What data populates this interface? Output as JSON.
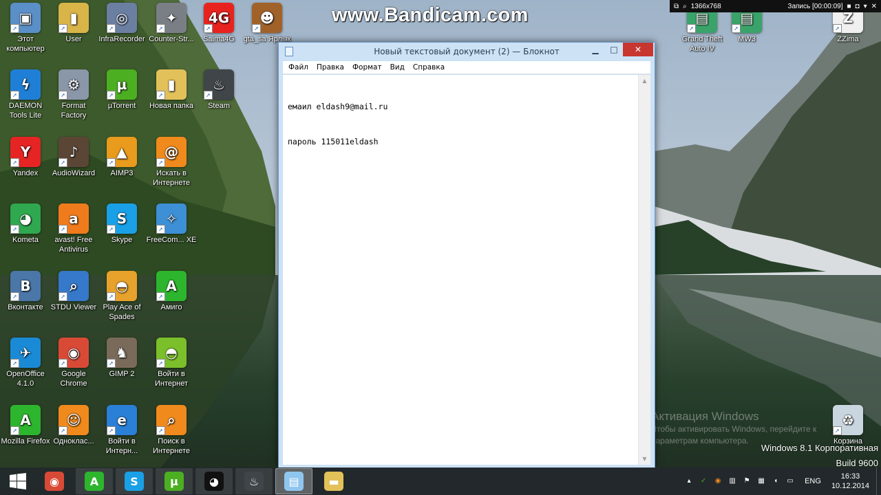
{
  "watermark": "www.Bandicam.com",
  "recorder": {
    "resolution": "1366x768",
    "recording": "Запись [00:00:09]"
  },
  "desktop_icons": [
    {
      "label": "Этот компьютер",
      "icon": "computer-icon",
      "color": "#5a8fc8",
      "glyph": "▣"
    },
    {
      "label": "User",
      "icon": "user-folder-icon",
      "color": "#d9b449",
      "glyph": "▮"
    },
    {
      "label": "InfraRecorder",
      "icon": "infrarecorder-icon",
      "color": "#6b7fa3",
      "glyph": "◎"
    },
    {
      "label": "Counter-Str...",
      "icon": "counter-strike-icon",
      "color": "#7a7f86",
      "glyph": "✦"
    },
    {
      "label": "Saima4G",
      "icon": "saima-4g-icon",
      "color": "#e8231f",
      "glyph": "4G"
    },
    {
      "label": "gta_sa Ярлык",
      "icon": "gta-sa-icon",
      "color": "#a1622a",
      "glyph": "☻"
    },
    {
      "label": "DAEMON Tools Lite",
      "icon": "daemon-tools-icon",
      "color": "#1f7fd6",
      "glyph": "ϟ"
    },
    {
      "label": "Format Factory",
      "icon": "format-factory-icon",
      "color": "#8a97a8",
      "glyph": "⚙"
    },
    {
      "label": "µTorrent",
      "icon": "utorrent-icon",
      "color": "#4caf22",
      "glyph": "µ"
    },
    {
      "label": "Новая папка",
      "icon": "folder-icon",
      "color": "#e3c15a",
      "glyph": "▮"
    },
    {
      "label": "Steam",
      "icon": "steam-icon",
      "color": "#3f4549",
      "glyph": "♨"
    },
    {
      "label": "Yandex",
      "icon": "yandex-browser-icon",
      "color": "#e62424",
      "glyph": "Y"
    },
    {
      "label": "AudioWizard",
      "icon": "audiowizard-icon",
      "color": "#5b4636",
      "glyph": "♪"
    },
    {
      "label": "AIMP3",
      "icon": "aimp-icon",
      "color": "#e89b1c",
      "glyph": "▲"
    },
    {
      "label": "Искать в Интернете",
      "icon": "internet-search-icon",
      "color": "#f08a1c",
      "glyph": "@"
    },
    {
      "label": "Kometa",
      "icon": "kometa-icon",
      "color": "#2fa84f",
      "glyph": "◕"
    },
    {
      "label": "avast! Free Antivirus",
      "icon": "avast-icon",
      "color": "#f07b1c",
      "glyph": "a"
    },
    {
      "label": "Skype",
      "icon": "skype-icon",
      "color": "#1aa0e6",
      "glyph": "S"
    },
    {
      "label": "FreeCom... XE",
      "icon": "freecommander-icon",
      "color": "#3d8fd6",
      "glyph": "✧"
    },
    {
      "label": "Вконтакте",
      "icon": "vkontakte-icon",
      "color": "#4a76a8",
      "glyph": "B"
    },
    {
      "label": "STDU Viewer",
      "icon": "stdu-viewer-icon",
      "color": "#3678c9",
      "glyph": "⌕"
    },
    {
      "label": "Play Ace of Spades",
      "icon": "ace-of-spades-icon",
      "color": "#e7a22b",
      "glyph": "◓"
    },
    {
      "label": "Амиго",
      "icon": "amigo-icon",
      "color": "#2eb52e",
      "glyph": "A"
    },
    {
      "label": "OpenOffice 4.1.0",
      "icon": "openoffice-icon",
      "color": "#1b8ad6",
      "glyph": "✈"
    },
    {
      "label": "Google Chrome",
      "icon": "chrome-icon",
      "color": "#d94a36",
      "glyph": "◉"
    },
    {
      "label": "GIMP 2",
      "icon": "gimp-icon",
      "color": "#7a6a5a",
      "glyph": "♞"
    },
    {
      "label": "Войти в Интернет",
      "icon": "internet-login-icon",
      "color": "#7bbf2a",
      "glyph": "◓"
    },
    {
      "label": "Mozilla Firefox",
      "icon": "amigo-firefox-icon",
      "color": "#2eb52e",
      "glyph": "A"
    },
    {
      "label": "Одноклас...",
      "icon": "odnoklassniki-icon",
      "color": "#f08a1c",
      "glyph": "☺"
    },
    {
      "label": "Войти в Интерн...",
      "icon": "internet-explorer-icon",
      "color": "#2a7fd6",
      "glyph": "e"
    },
    {
      "label": "Поиск в Интернете",
      "icon": "internet-search-2-icon",
      "color": "#f08a1c",
      "glyph": "⌕"
    },
    {
      "label": "Grand Theft Auto IV",
      "icon": "gta-iv-icon",
      "color": "#3aa36a",
      "glyph": "▤"
    },
    {
      "label": "MW3",
      "icon": "mw3-icon",
      "color": "#3aa36a",
      "glyph": "▤"
    },
    {
      "label": "ZZima",
      "icon": "zzima-icon",
      "color": "#f0f0f0",
      "glyph": "Z"
    },
    {
      "label": "Корзина",
      "icon": "recycle-bin-icon",
      "color": "#c9d6df",
      "glyph": "♻"
    }
  ],
  "notepad": {
    "title": "Новый текстовый документ (2) — Блокнот",
    "menu": [
      "Файл",
      "Правка",
      "Формат",
      "Вид",
      "Справка"
    ],
    "content_lines": [
      "емаил eldash9@mail.ru",
      "пароль 115011eldash"
    ]
  },
  "activation": {
    "line1": "Активация Windows",
    "line2": "Чтобы активировать Windows, перейдите к",
    "line3": "параметрам компьютера."
  },
  "build": {
    "line1": "Windows 8.1 Корпоративная",
    "line2": "Build 9600"
  },
  "taskbar": {
    "apps": [
      {
        "name": "chrome-icon",
        "color": "#d94a36",
        "glyph": "◉",
        "state": ""
      },
      {
        "name": "amigo-icon",
        "color": "#2eb52e",
        "glyph": "A",
        "state": "running"
      },
      {
        "name": "skype-icon",
        "color": "#1aa0e6",
        "glyph": "S",
        "state": "running"
      },
      {
        "name": "utorrent-icon",
        "color": "#4caf22",
        "glyph": "µ",
        "state": "running"
      },
      {
        "name": "bandicam-icon",
        "color": "#111111",
        "glyph": "◕",
        "state": "running"
      },
      {
        "name": "steam-icon",
        "color": "#3f4549",
        "glyph": "♨",
        "state": "running"
      },
      {
        "name": "notepad-icon",
        "color": "#8fc6ef",
        "glyph": "▤",
        "state": "active"
      },
      {
        "name": "file-explorer-icon",
        "color": "#e3c15a",
        "glyph": "▬",
        "state": ""
      }
    ],
    "language": "ENG",
    "time": "16:33",
    "date": "10.12.2014"
  }
}
